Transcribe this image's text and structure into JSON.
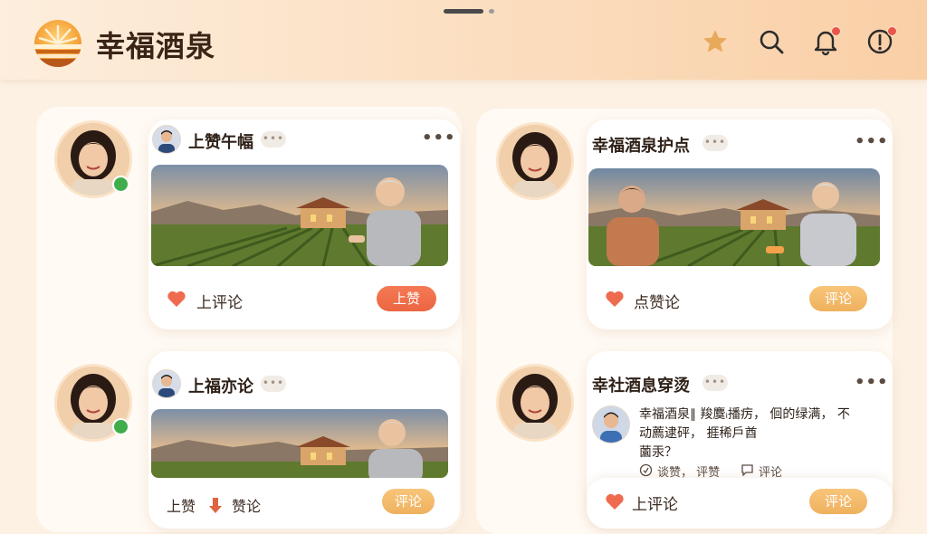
{
  "app": {
    "title": "幸福酒泉"
  },
  "header_icons": [
    "star-icon",
    "search-icon",
    "bell-icon",
    "alert-icon"
  ],
  "colors": {
    "accent": "#ec6541",
    "gold": "#eeb15e",
    "online": "#3fae4a",
    "badge": "#e8564b"
  },
  "feed": [
    {
      "username": "上赞午幅",
      "dots": "•••",
      "more": "•••",
      "action_label": "上评论",
      "button_label": "上赞"
    },
    {
      "username": "幸福酒泉护点",
      "dots": "•••",
      "more": "•••",
      "action_label": "点赞论",
      "button_label": "评论"
    },
    {
      "username": "上福亦论",
      "dots": "•••",
      "more": "•••",
      "action_left": "上赞",
      "action_label": "赞论",
      "button_label": "评论"
    },
    {
      "username": "幸社酒息穿烫",
      "dots": "•••",
      "more": "•••",
      "text_lines": [
        "幸福酒泉∥ 羧麌ᵢ播疠， 佪的绿满， 不",
        "动薦逮砰， 捱稀戶酋",
        "薗汞？"
      ],
      "meta_like": "谈赞， 评赞",
      "meta_comment": "评论",
      "action_label": "上评论",
      "button_label": "评论"
    }
  ]
}
